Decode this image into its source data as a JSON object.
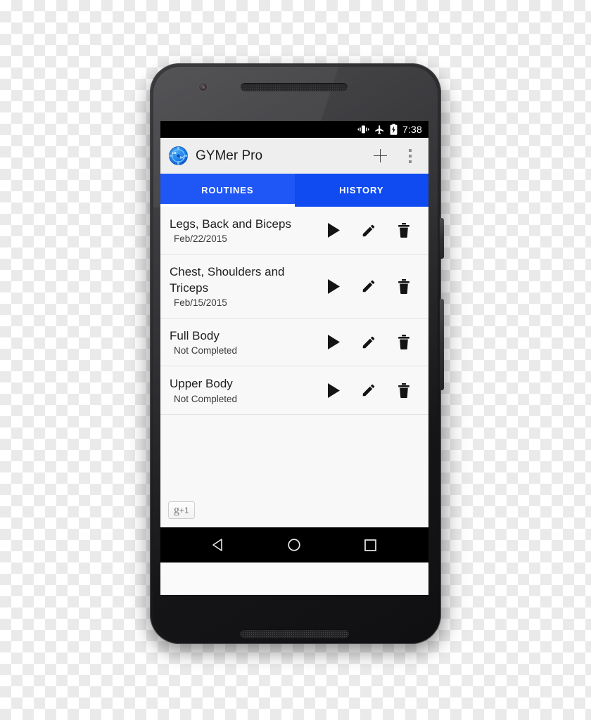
{
  "scene": {
    "background": "transparency-checkerboard",
    "device": "android-smartphone-mockup"
  },
  "status_bar": {
    "time": "7:38",
    "icons": [
      "vibrate-icon",
      "airplane-mode-icon",
      "battery-charging-icon"
    ]
  },
  "app_bar": {
    "logo_icon": "gymer-weight-plate-icon",
    "logo_text_left": "LB",
    "logo_text_right": "KG",
    "title": "GYMer Pro",
    "add_label": "add-icon",
    "overflow_label": "more-options-icon"
  },
  "tabs": {
    "selected_index": 0,
    "items": [
      {
        "label": "ROUTINES"
      },
      {
        "label": "HISTORY"
      }
    ],
    "active_color": "#1f57f7",
    "inactive_color": "#0f4bf0",
    "indicator_color": "#ffffff"
  },
  "routines": [
    {
      "title": "Legs, Back and Biceps",
      "subtitle": "Feb/22/2015"
    },
    {
      "title": "Chest, Shoulders and Triceps",
      "subtitle": "Feb/15/2015"
    },
    {
      "title": "Full Body",
      "subtitle": "Not Completed"
    },
    {
      "title": "Upper Body",
      "subtitle": "Not Completed"
    }
  ],
  "row_actions": {
    "play": "play-icon",
    "edit": "edit-pencil-icon",
    "delete": "delete-trash-icon"
  },
  "gplus": {
    "g": "g",
    "plusone": "+1"
  },
  "nav_bar": {
    "back": "back-triangle-icon",
    "home": "home-circle-icon",
    "recents": "recents-square-icon"
  }
}
